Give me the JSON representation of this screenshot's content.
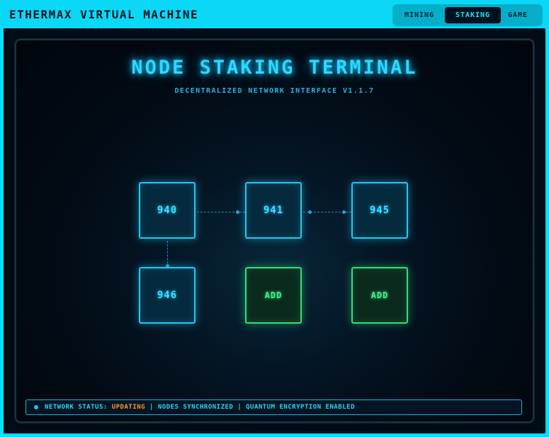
{
  "window": {
    "title": "ETHERMAX VIRTUAL MACHINE"
  },
  "nav": {
    "tabs": [
      {
        "label": "MINING",
        "active": false
      },
      {
        "label": "STAKING",
        "active": true
      },
      {
        "label": "GAME",
        "active": false
      }
    ]
  },
  "terminal": {
    "title": "NODE STAKING TERMINAL",
    "subtitle": "DECENTRALIZED NETWORK INTERFACE V1.1.7"
  },
  "nodes": [
    {
      "label": "940",
      "kind": "node"
    },
    {
      "label": "941",
      "kind": "node"
    },
    {
      "label": "945",
      "kind": "node"
    },
    {
      "label": "946",
      "kind": "node"
    },
    {
      "label": "ADD",
      "kind": "add"
    },
    {
      "label": "ADD",
      "kind": "add"
    }
  ],
  "status": {
    "prefix": "NETWORK STATUS: ",
    "state": "UPDATING",
    "suffix": " | NODES SYNCHRONIZED | QUANTUM ENCRYPTION ENABLED"
  },
  "colors": {
    "accent": "#00e1ff",
    "node_blue": "#25c8f0",
    "node_green": "#34df7a",
    "status_warning": "#ff9a1f",
    "background": "#020a13"
  }
}
